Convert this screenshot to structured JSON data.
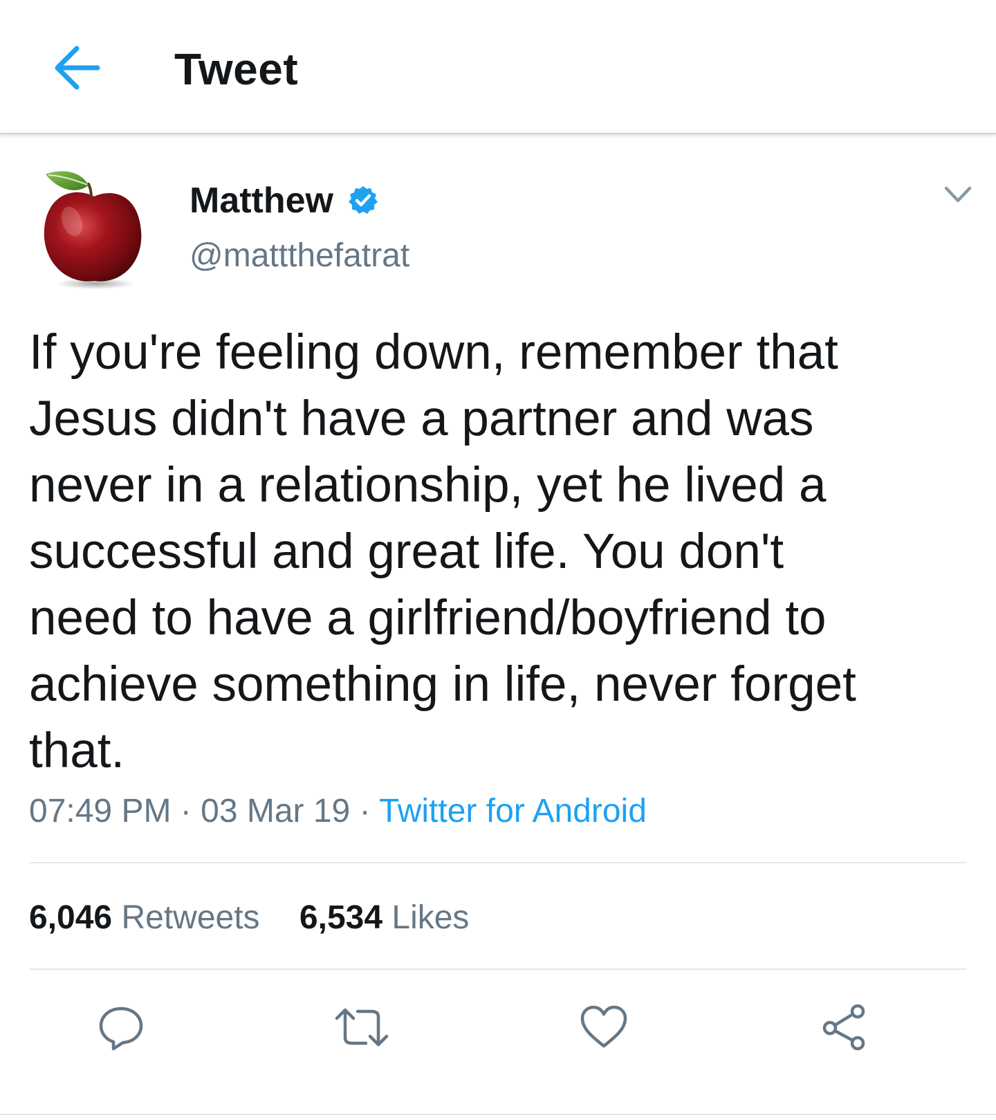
{
  "header": {
    "title": "Tweet",
    "back_icon": "arrow-left-icon",
    "accent_color": "#1da1f2"
  },
  "author": {
    "display_name": "Matthew",
    "handle": "@mattthefatrat",
    "verified": true,
    "avatar": "red-apple-avatar"
  },
  "tweet": {
    "text": "If you're feeling down, remember that\nJesus didn't have a partner and was\nnever in a relationship, yet he lived a\nsuccessful and great life. You don't\nneed to have a girlfriend/boyfriend to\nachieve something in life, never forget\nthat.",
    "time": "07:49 PM",
    "separator": "·",
    "date": "03 Mar 19",
    "source": "Twitter for Android"
  },
  "stats": {
    "retweets_count": "6,046",
    "retweets_label": "Retweets",
    "likes_count": "6,534",
    "likes_label": "Likes"
  },
  "actions": [
    {
      "name": "reply",
      "icon": "reply-icon"
    },
    {
      "name": "retweet",
      "icon": "retweet-icon"
    },
    {
      "name": "like",
      "icon": "heart-icon"
    },
    {
      "name": "share",
      "icon": "share-icon"
    }
  ],
  "colors": {
    "text_primary": "#14171a",
    "text_secondary": "#657786",
    "link": "#1da1f2",
    "verified_badge": "#1da1f2",
    "divider": "#e1e8ed"
  }
}
